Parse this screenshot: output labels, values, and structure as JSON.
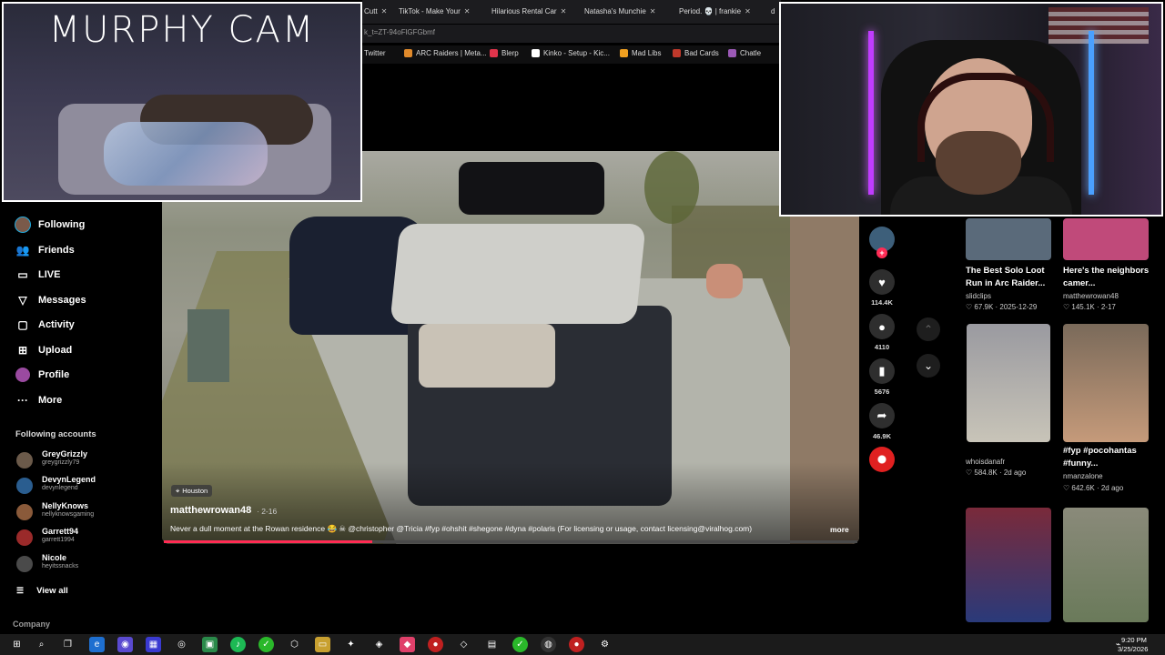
{
  "browser": {
    "tabs": [
      {
        "label": "Cutt"
      },
      {
        "label": "TikTok - Make Your"
      },
      {
        "label": "Hilarious Rental Car"
      },
      {
        "label": "Natasha's Munchie"
      },
      {
        "label": "Period. 💀 | frankie"
      },
      {
        "label": "d"
      }
    ],
    "url": "k_t=ZT-94oFlGFGbmf",
    "bookmarks": [
      {
        "label": "Twitter",
        "color": "#1d9bf0"
      },
      {
        "label": "ARC Raiders | Meta...",
        "color": "#e08a2b"
      },
      {
        "label": "Blerp",
        "color": "#e0344b"
      },
      {
        "label": "Kinko - Setup - Kic...",
        "color": "#ffffff"
      },
      {
        "label": "Mad Libs",
        "color": "#f0a020"
      },
      {
        "label": "Bad Cards",
        "color": "#c0392b"
      },
      {
        "label": "Chatle",
        "color": "#9b59b6"
      }
    ]
  },
  "overlays": {
    "murphy_cam_title": "MURPHY CAM"
  },
  "sidebar": {
    "nav": [
      {
        "label": "Following",
        "icon": "avatar-icon"
      },
      {
        "label": "Friends",
        "icon": "friends-icon"
      },
      {
        "label": "LIVE",
        "icon": "live-icon"
      },
      {
        "label": "Messages",
        "icon": "messages-icon"
      },
      {
        "label": "Activity",
        "icon": "activity-icon"
      },
      {
        "label": "Upload",
        "icon": "upload-icon"
      },
      {
        "label": "Profile",
        "icon": "profile-icon"
      },
      {
        "label": "More",
        "icon": "more-icon"
      }
    ],
    "following_title": "Following accounts",
    "accounts": [
      {
        "name": "GreyGrizzly",
        "handle": "greygrizzly79",
        "color": "#6b5a4a"
      },
      {
        "name": "DevynLegend",
        "handle": "devynlegend",
        "color": "#2a5d8f"
      },
      {
        "name": "NellyKnows",
        "handle": "nellyknowsgaming",
        "color": "#8a5a3a"
      },
      {
        "name": "Garrett94",
        "handle": "garrett1994",
        "color": "#9a2a2a"
      },
      {
        "name": "Nicole",
        "handle": "heyitssnacks",
        "color": "#4a4a4a"
      }
    ],
    "view_all": "View all",
    "company": "Company"
  },
  "video": {
    "location": "Houston",
    "author": "matthewrowan48",
    "date": "· 2-16",
    "caption": "Never a dull moment at the Rowan residence 😂 ☠ @christopher @Tricia #fyp #ohshit #shegone #dyna #polaris (For licensing or usage, contact licensing@viralhog.com)",
    "more": "more",
    "progress": 0.3
  },
  "actions": {
    "likes": "114.4K",
    "comments": "4110",
    "saves": "5676",
    "shares": "46.9K"
  },
  "grid": [
    {
      "title": "The Best Solo Loot Run in Arc Raider...",
      "author": "slidclips",
      "stats": "♡ 67.9K · 2025-12-29",
      "color": "#5a6a7a"
    },
    {
      "title": "Here's the neighbors camer...",
      "author": "matthewrowan48",
      "stats": "♡ 145.1K · 2-17",
      "color": "#c04a7a"
    },
    {
      "title": "",
      "author": "whoisdanafr",
      "stats": "♡ 584.8K · 2d ago",
      "color": "#8a8a8e"
    },
    {
      "title": "#fyp #pocohantas #funny...",
      "author": "nmanzalone",
      "stats": "♡ 642.6K · 2d ago",
      "color": "#b08a6a"
    },
    {
      "title": "",
      "author": "",
      "stats": "",
      "color": "#7a2a3a"
    },
    {
      "title": "",
      "author": "",
      "stats": "",
      "color": "#6a7a5a"
    }
  ],
  "taskbar": {
    "time": "9:20 PM",
    "date": "3/25/2026"
  }
}
